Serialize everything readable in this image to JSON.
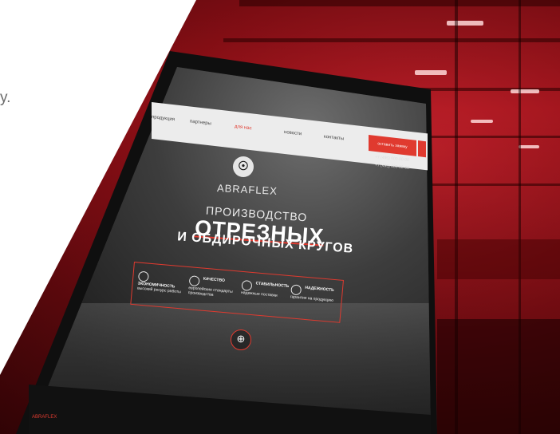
{
  "side_text": "у.",
  "site": {
    "nav": {
      "items": [
        "продукция",
        "партнеры",
        "для нас",
        "новости",
        "контакты"
      ],
      "active_index": 2,
      "cta_label": "оставить заявку"
    },
    "contacts": [
      "+7 (495) 000-00-00",
      "+7 (495) 000-00-00"
    ],
    "brand": "ABRAFLEX",
    "hero": {
      "line1": "ПРОИЗВОДСТВО",
      "line2": "ОТРЕЗНЫХ",
      "line3": "И ОБДИРОЧНЫХ КРУГОВ"
    },
    "features": [
      {
        "title": "ЭКОНОМИЧНОСТЬ",
        "desc": "высокий ресурс работы"
      },
      {
        "title": "КАЧЕСТВО",
        "desc": "европейские стандарты производства"
      },
      {
        "title": "СТАБИЛЬНОСТЬ",
        "desc": "надежные поставки"
      },
      {
        "title": "НАДЕЖНОСТЬ",
        "desc": "гарантия на продукцию"
      }
    ],
    "footer_brand": "ABRAFLEX"
  },
  "colors": {
    "accent": "#e03a2f",
    "backdrop": "#a3141c"
  }
}
